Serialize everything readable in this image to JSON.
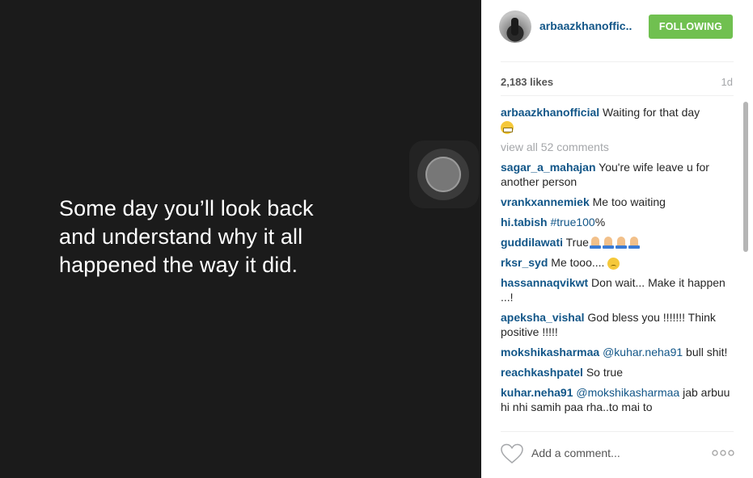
{
  "media": {
    "quote": "Some day you’ll look back and understand why it all happened the way it did."
  },
  "post": {
    "username": "arbaazkhanoffic..",
    "follow_label": "FOLLOWING",
    "likes": "2,183 likes",
    "age": "1d",
    "caption_user": "arbaazkhanofficial",
    "caption_text": "Waiting for that day",
    "view_all": "view all 52 comments"
  },
  "comments": [
    {
      "user": "sagar_a_mahajan",
      "text": "You're wife leave u for another person"
    },
    {
      "user": "vrankxannemiek",
      "text": "Me too waiting"
    },
    {
      "user": "hi.tabish",
      "mention": "#true100",
      "text": "%"
    },
    {
      "user": "guddilawati",
      "text": "True"
    },
    {
      "user": "rksr_syd",
      "text": "Me tooo...."
    },
    {
      "user": "hassannaqvikwt",
      "text": "Don wait... Make it happen ...!"
    },
    {
      "user": "apeksha_vishal",
      "text": "God bless you !!!!!!! Think positive !!!!!"
    },
    {
      "user": "mokshikasharmaa",
      "mention": "@kuhar.neha91",
      "text": "bull shit!"
    },
    {
      "user": "reachkashpatel",
      "text": "So true"
    },
    {
      "user": "kuhar.neha91",
      "mention": "@mokshikasharmaa",
      "text": "jab arbuu hi nhi samih paa rha..to mai to"
    }
  ],
  "footer": {
    "placeholder": "Add a comment..."
  },
  "icons": {
    "heart": "heart-outline-icon",
    "more": "more-dots-icon",
    "grin_emoji": "grimacing-face-emoji",
    "sad_emoji": "disappointed-face-emoji",
    "pray_emoji": "folded-hands-emoji"
  },
  "colors": {
    "link": "#125688",
    "follow_button": "#70c050",
    "media_bg": "#1b1b1b"
  }
}
